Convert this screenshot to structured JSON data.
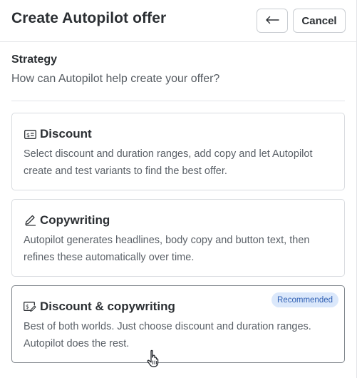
{
  "header": {
    "title": "Create Autopilot offer",
    "back_icon": "arrow-left-icon",
    "cancel_label": "Cancel"
  },
  "strategy": {
    "title": "Strategy",
    "subtitle": "How can Autopilot help create your offer?"
  },
  "options": [
    {
      "icon": "discount-tag-icon",
      "title": "Discount",
      "description": "Select discount and duration ranges, add copy and let Autopilot create and test variants to find the best offer.",
      "selected": false
    },
    {
      "icon": "pencil-icon",
      "title": "Copywriting",
      "description": "Autopilot generates headlines, body copy and button text, then refines these automatically over time.",
      "selected": false
    },
    {
      "icon": "discount-edit-icon",
      "title": "Discount & copywriting",
      "description": "Best of both worlds. Just choose discount and duration ranges. Autopilot does the rest.",
      "badge": "Recommended",
      "selected": true
    }
  ],
  "colors": {
    "badge_bg": "#dbe8fb",
    "badge_text": "#2f5fb3",
    "border": "#d9dce0"
  }
}
